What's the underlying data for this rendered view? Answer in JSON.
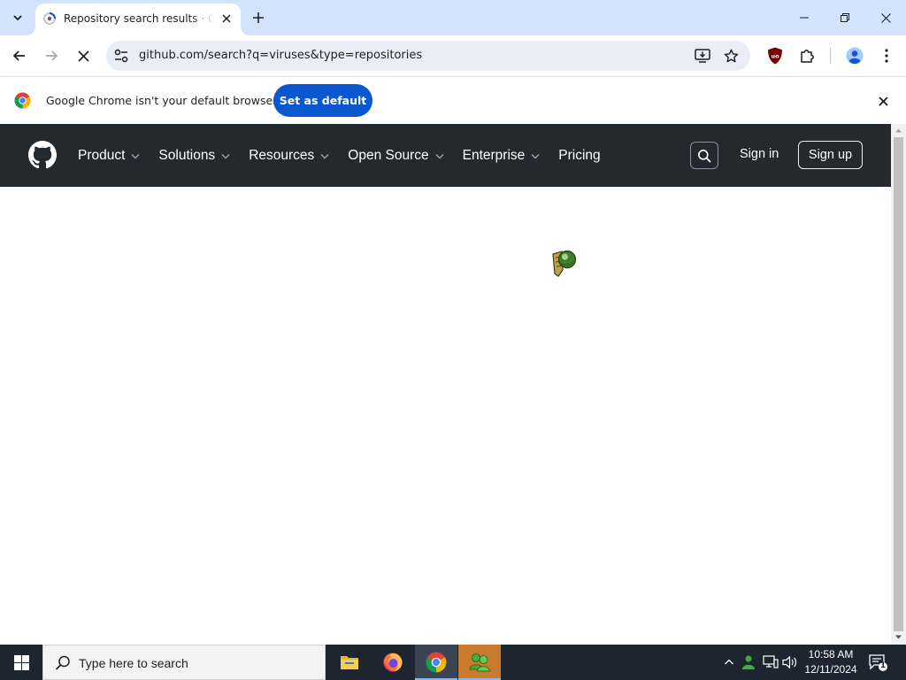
{
  "browser": {
    "tab": {
      "title": "Repository search results · GitHub"
    },
    "address_bar": {
      "url": "github.com/search?q=viruses&type=repositories"
    },
    "infobar": {
      "message": "Google Chrome isn't your default browser",
      "button_label": "Set as default"
    },
    "colors": {
      "tabstrip": "#d3e3fd",
      "omnibox": "#e9eef6",
      "primary_button": "#0b57d0"
    }
  },
  "github": {
    "nav": [
      {
        "label": "Product",
        "has_dropdown": true
      },
      {
        "label": "Solutions",
        "has_dropdown": true
      },
      {
        "label": "Resources",
        "has_dropdown": true
      },
      {
        "label": "Open Source",
        "has_dropdown": true
      },
      {
        "label": "Enterprise",
        "has_dropdown": true
      },
      {
        "label": "Pricing",
        "has_dropdown": false
      }
    ],
    "sign_in_label": "Sign in",
    "sign_up_label": "Sign up",
    "colors": {
      "header_bg": "#24292f"
    }
  },
  "taskbar": {
    "search_placeholder": "Type here to search",
    "apps": [
      "file-explorer-icon",
      "firefox-icon",
      "chrome-icon",
      "people-app-icon"
    ],
    "clock": {
      "time": "10:58 AM",
      "date": "12/11/2024"
    },
    "notification_count": "1",
    "colors": {
      "bar": "#1c2530"
    }
  }
}
